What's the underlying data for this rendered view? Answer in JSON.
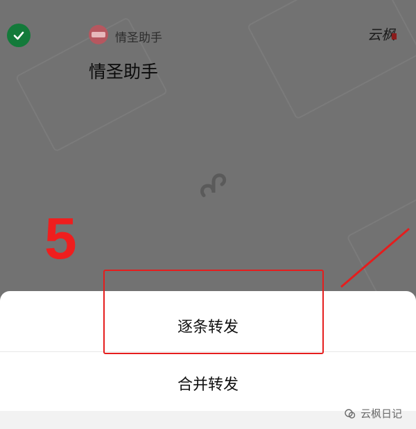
{
  "message": {
    "app_name": "情圣助手",
    "title": "情圣助手"
  },
  "annotation": {
    "step_number": "5"
  },
  "sheet": {
    "option_one": "逐条转发",
    "option_two": "合并转发"
  },
  "footer": {
    "watermark": "云枫日记"
  },
  "colors": {
    "check_green": "#137a3a",
    "annotation_red": "#e51d1d"
  }
}
